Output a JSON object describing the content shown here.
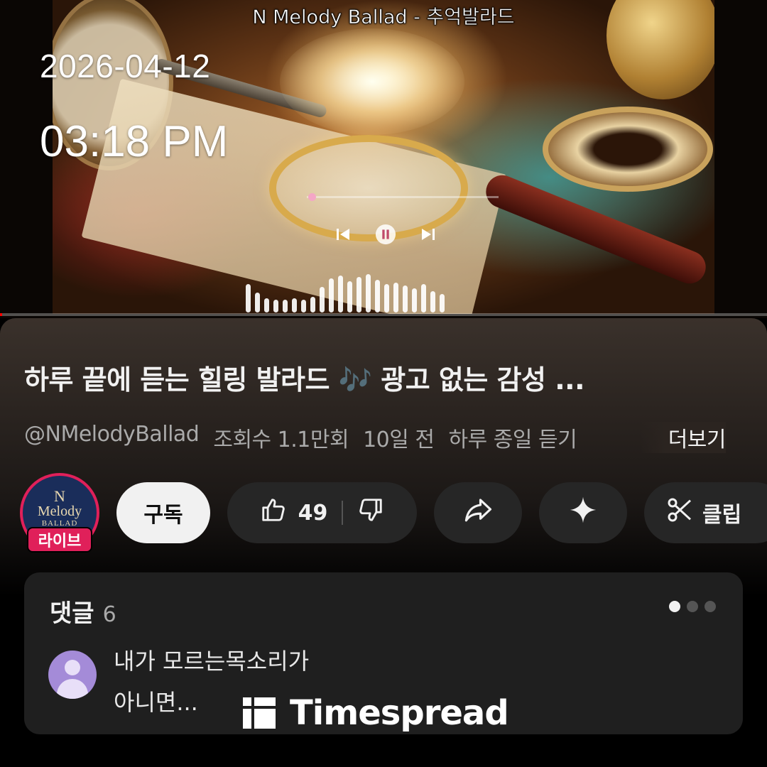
{
  "video": {
    "title_overlay": "N Melody Ballad - 추억발라드",
    "overlay_date": "2026-04-12",
    "overlay_time": "03:18 PM",
    "seek_progress": 0.003
  },
  "video_info": {
    "title": "하루 끝에 듣는 힐링 발라드 🎶 광고 없는 감성 ...",
    "channel_handle": "@NMelodyBallad",
    "views": "조회수 1.1만회",
    "age": "10일 전",
    "description_snippet": "하루 종일 듣기",
    "more_label": "더보기"
  },
  "channel": {
    "logo_line1": "N",
    "logo_line2": "Melody",
    "logo_line3": "BALLAD",
    "live_badge": "라이브"
  },
  "actions": {
    "subscribe_label": "구독",
    "like_count": "49",
    "clip_label": "클립"
  },
  "comments": {
    "label": "댓글",
    "count": "6",
    "first_comment": "내가  모르는목소리가\n아니면...",
    "page_dots": 3,
    "active_dot": 0
  },
  "watermark": {
    "text": "Timespread"
  },
  "icons": [
    "previous-icon",
    "pause-icon",
    "next-icon",
    "thumbs-up-icon",
    "thumbs-down-icon",
    "share-icon",
    "sparkle-icon",
    "scissors-icon"
  ],
  "colors": {
    "accent_red": "#ff0000",
    "live_pink": "#e0205a",
    "panel_bg": "#1f1f1f"
  }
}
